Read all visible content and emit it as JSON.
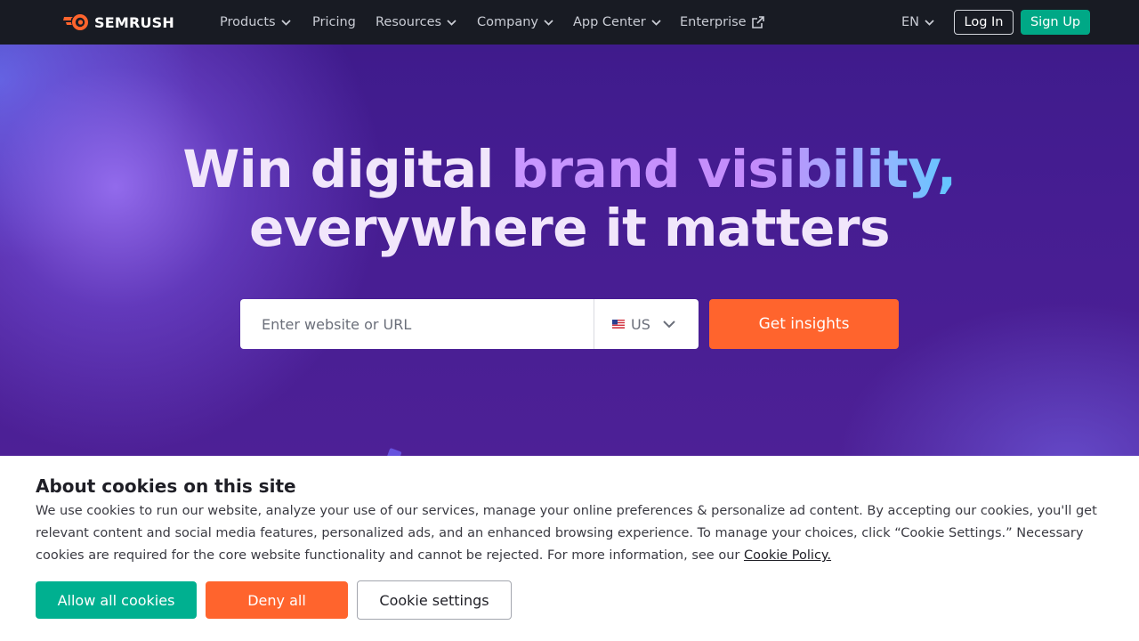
{
  "nav": {
    "logo_text": "SEMRUSH",
    "items": [
      {
        "label": "Products"
      },
      {
        "label": "Pricing"
      },
      {
        "label": "Resources"
      },
      {
        "label": "Company"
      },
      {
        "label": "App Center"
      },
      {
        "label": "Enterprise"
      }
    ],
    "language": "EN",
    "login_label": "Log In",
    "signup_label": "Sign Up"
  },
  "hero": {
    "line1_part1": "Win digital ",
    "line1_part2": "brand visibility,",
    "line2": "everywhere it matters",
    "search_placeholder": "Enter website or URL",
    "region": "US",
    "cta_label": "Get insights"
  },
  "cookie_banner": {
    "title": "About cookies on this site",
    "body": "We use cookies to run our website, analyze your use of our services, manage your online preferences & personalize ad content. By accepting our cookies, you'll get relevant content and social media features, personalized ads, and an enhanced browsing experience. To manage your choices, click “Cookie Settings.” Necessary cookies are required for the core website functionality and cannot be rejected. For more information, see our ",
    "policy_link": "Cookie Policy.",
    "allow_label": "Allow all cookies",
    "deny_label": "Deny all",
    "settings_label": "Cookie settings"
  },
  "colors": {
    "brand_orange": "#ff642d",
    "signup_green": "#00a886",
    "nav_bg": "#181b23",
    "hero_purple": "#461d92"
  },
  "icons": {
    "logo": "semrush-fireball-icon",
    "dropdown": "chevron-down-icon",
    "external": "external-link-icon",
    "flag": "us-flag-icon"
  }
}
